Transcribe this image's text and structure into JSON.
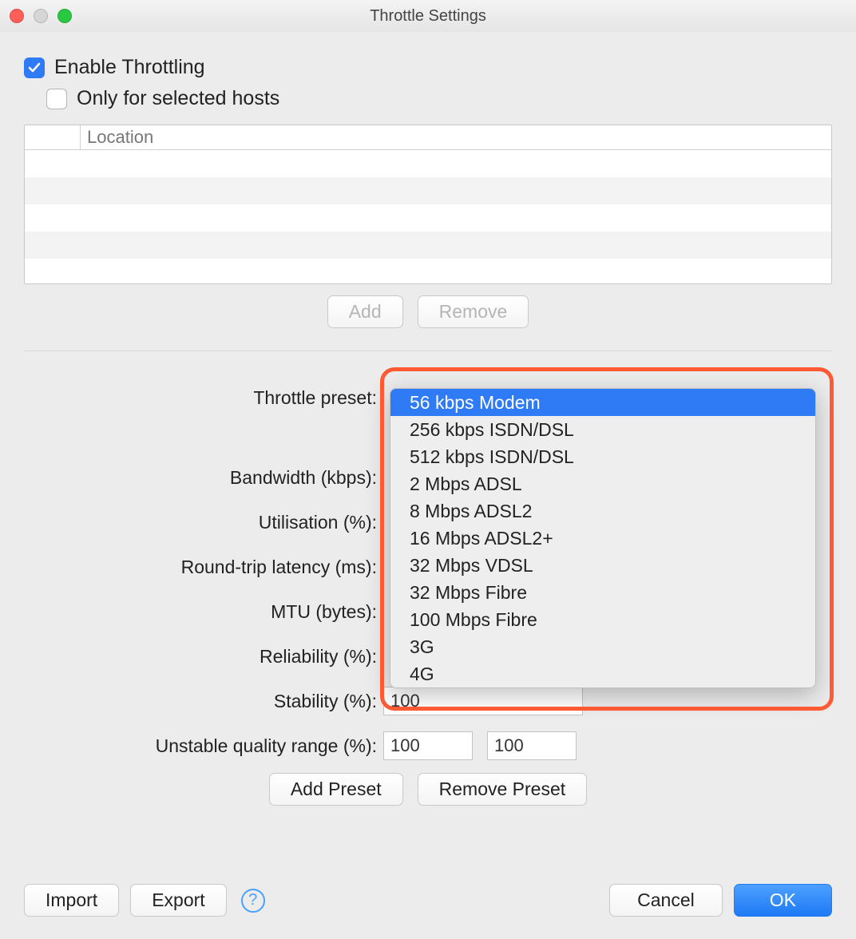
{
  "window": {
    "title": "Throttle Settings"
  },
  "checks": {
    "enable_label": "Enable Throttling",
    "enable_checked": true,
    "only_label": "Only for selected hosts",
    "only_checked": false
  },
  "table": {
    "header": "Location"
  },
  "host_buttons": {
    "add": "Add",
    "remove": "Remove"
  },
  "labels": {
    "preset": "Throttle preset:",
    "bandwidth": "Bandwidth (kbps):",
    "utilisation": "Utilisation (%):",
    "rtt": "Round-trip latency (ms):",
    "mtu": "MTU (bytes):",
    "reliability": "Reliability (%):",
    "stability": "Stability (%):",
    "uqr": "Unstable quality range (%):"
  },
  "values": {
    "stability": "100",
    "uqr_lo": "100",
    "uqr_hi": "100"
  },
  "preset_options": [
    "56 kbps Modem",
    "256 kbps ISDN/DSL",
    "512 kbps ISDN/DSL",
    "2 Mbps ADSL",
    "8 Mbps ADSL2",
    "16 Mbps ADSL2+",
    "32 Mbps VDSL",
    "32 Mbps Fibre",
    "100 Mbps Fibre",
    "3G",
    "4G"
  ],
  "preset_selected_index": 0,
  "preset_buttons": {
    "add": "Add Preset",
    "remove": "Remove Preset"
  },
  "footer": {
    "import": "Import",
    "export": "Export",
    "help": "?",
    "cancel": "Cancel",
    "ok": "OK"
  }
}
